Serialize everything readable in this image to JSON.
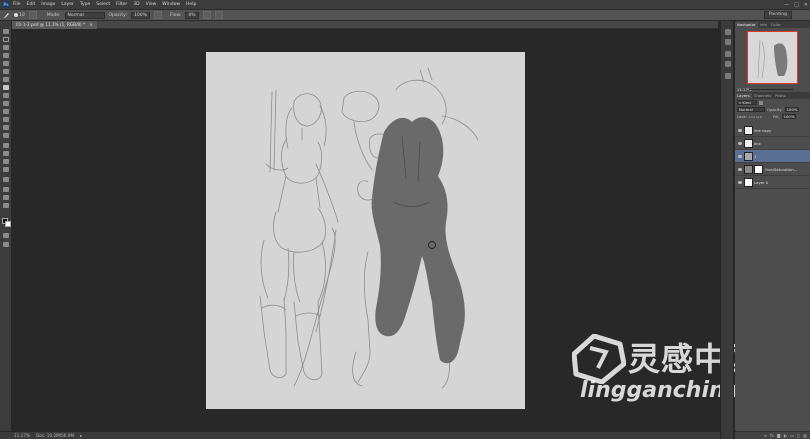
{
  "app": {
    "logo_text": "Ps"
  },
  "menu": [
    "File",
    "Edit",
    "Image",
    "Layer",
    "Type",
    "Select",
    "Filter",
    "3D",
    "View",
    "Window",
    "Help"
  ],
  "window_controls": [
    "—",
    "□",
    "✕"
  ],
  "options_bar": {
    "brush_size": "10",
    "mode_label": "Mode:",
    "mode_value": "Normal",
    "opacity_label": "Opacity:",
    "opacity_value": "100%",
    "flow_label": "Flow:",
    "flow_value": "0%"
  },
  "workspace": "Painting",
  "document": {
    "tab_title": "01-1-2.psd @ 11.1% (1, RGB/8) *"
  },
  "status": {
    "zoom": "11.17%",
    "doc_size": "Doc: 10.2M/56.9M"
  },
  "panels": {
    "top_tabs": [
      "Navigator",
      "Info",
      "Color"
    ],
    "navigator_zoom": "11.17%",
    "layers_tabs": [
      "Layers",
      "Channels",
      "Paths"
    ],
    "kind_label": "Kind",
    "blend_mode": "Normal",
    "opacity_label": "Opacity:",
    "opacity_value": "100%",
    "fill_label": "Fill:",
    "fill_value": "100%",
    "lock_label": "Lock:",
    "layers": [
      {
        "name": "line copy",
        "selected": false
      },
      {
        "name": "line",
        "selected": false
      },
      {
        "name": "1",
        "selected": true
      },
      {
        "name": "Hue/Saturation...",
        "selected": false
      },
      {
        "name": "Layer 0",
        "selected": false
      }
    ],
    "footer_icons": [
      "link-icon",
      "fx-icon",
      "mask-icon",
      "adjust-icon",
      "folder-icon",
      "new-layer-icon",
      "trash-icon"
    ]
  },
  "watermark": {
    "chinese": "灵感中国",
    "domain": "lingganchina.com"
  }
}
